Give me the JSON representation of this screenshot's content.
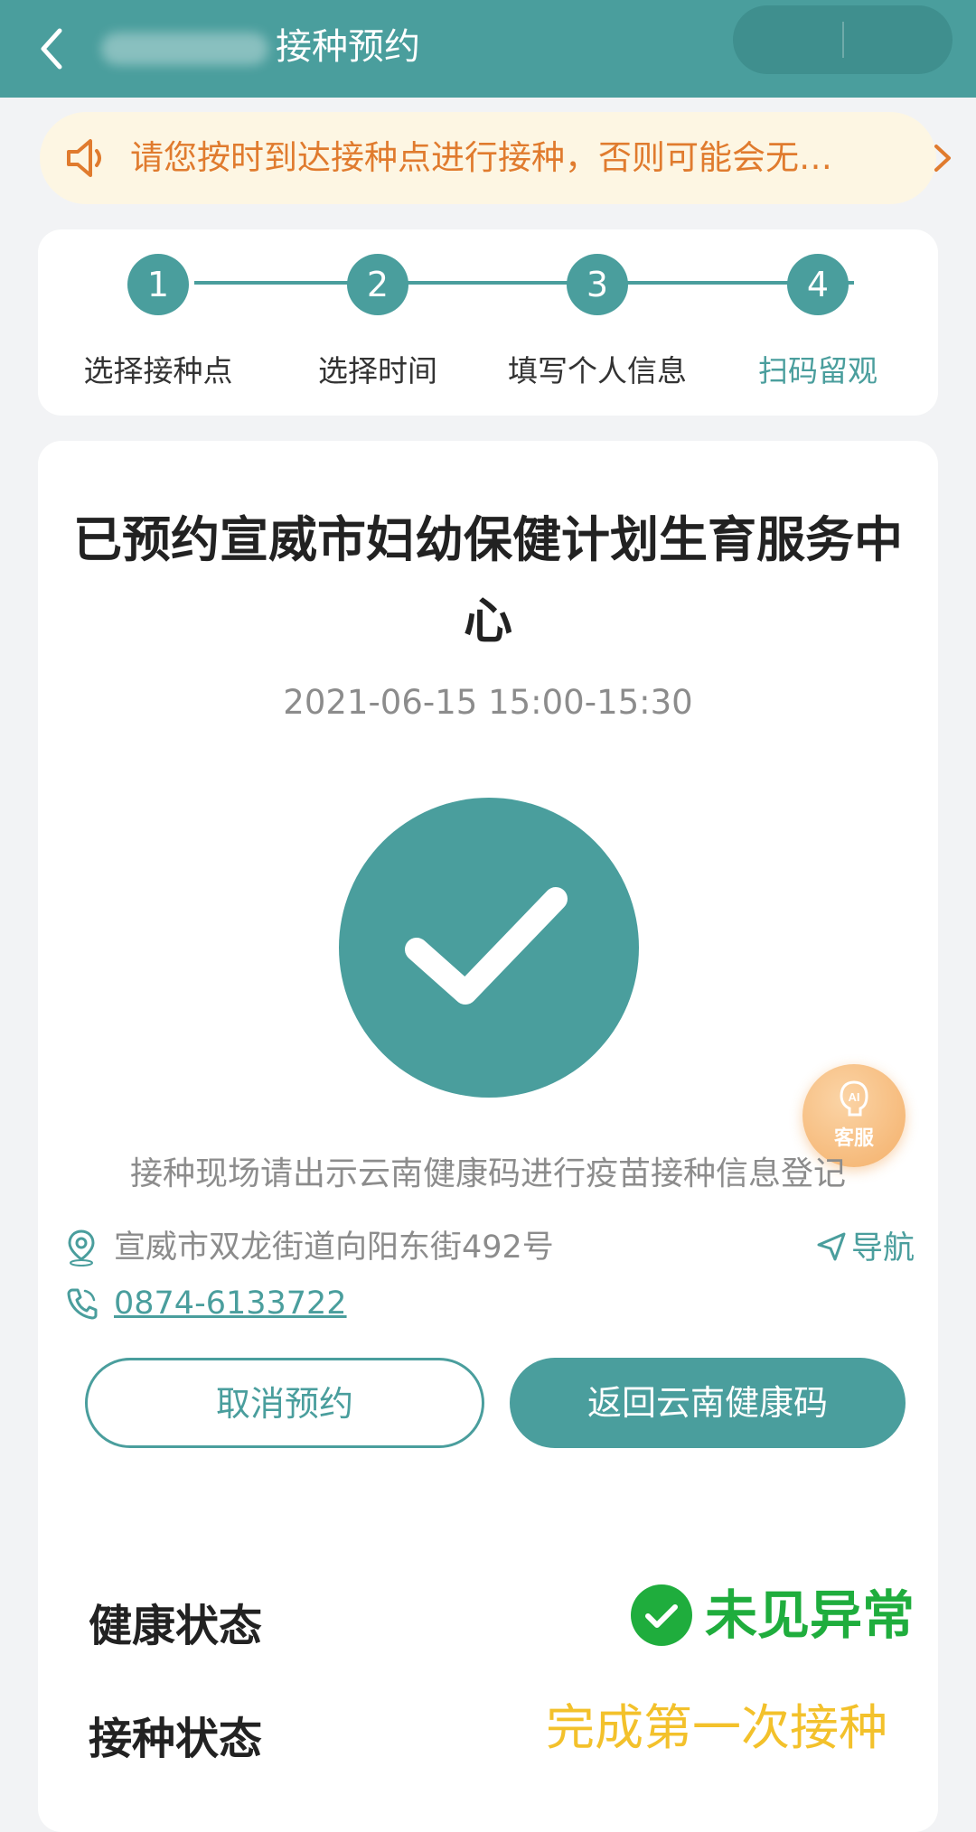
{
  "header": {
    "title": "接种预约",
    "back_icon": "chevron-left-icon",
    "capsule_icons": [
      "more-icon",
      "close-icon"
    ],
    "bg_color": "#4a9e9d"
  },
  "notice": {
    "icon": "speaker-icon",
    "text": "请您按时到达接种点进行接种，否则可能会无…",
    "chevron_icon": "chevron-right-icon",
    "color": "#e07b2e"
  },
  "steps": [
    {
      "number": "1",
      "label": "选择接种点"
    },
    {
      "number": "2",
      "label": "选择时间"
    },
    {
      "number": "3",
      "label": "填写个人信息"
    },
    {
      "number": "4",
      "label": "扫码留观"
    }
  ],
  "appointment": {
    "title": "已预约宣威市妇幼保健计划生育服务中心",
    "datetime": "2021-06-15 15:00-15:30",
    "success_icon": "checkmark-icon",
    "instruction": "接种现场请出示云南健康码进行疫苗接种信息登记",
    "address": "宣威市双龙街道向阳东街492号",
    "navigate_label": "导航",
    "phone": "0874-6133722"
  },
  "ai_service": {
    "icon": "ai-robot-icon",
    "label": "客服"
  },
  "buttons": {
    "cancel_label": "取消预约",
    "return_label": "返回云南健康码"
  },
  "status": {
    "health_label": "健康状态",
    "health_value": "未见异常",
    "health_color": "#1fad3d",
    "vaccination_label": "接种状态",
    "vaccination_value": "完成第一次接种",
    "vaccination_color": "#f3c12b"
  },
  "accent_color": "#4a9e9d"
}
